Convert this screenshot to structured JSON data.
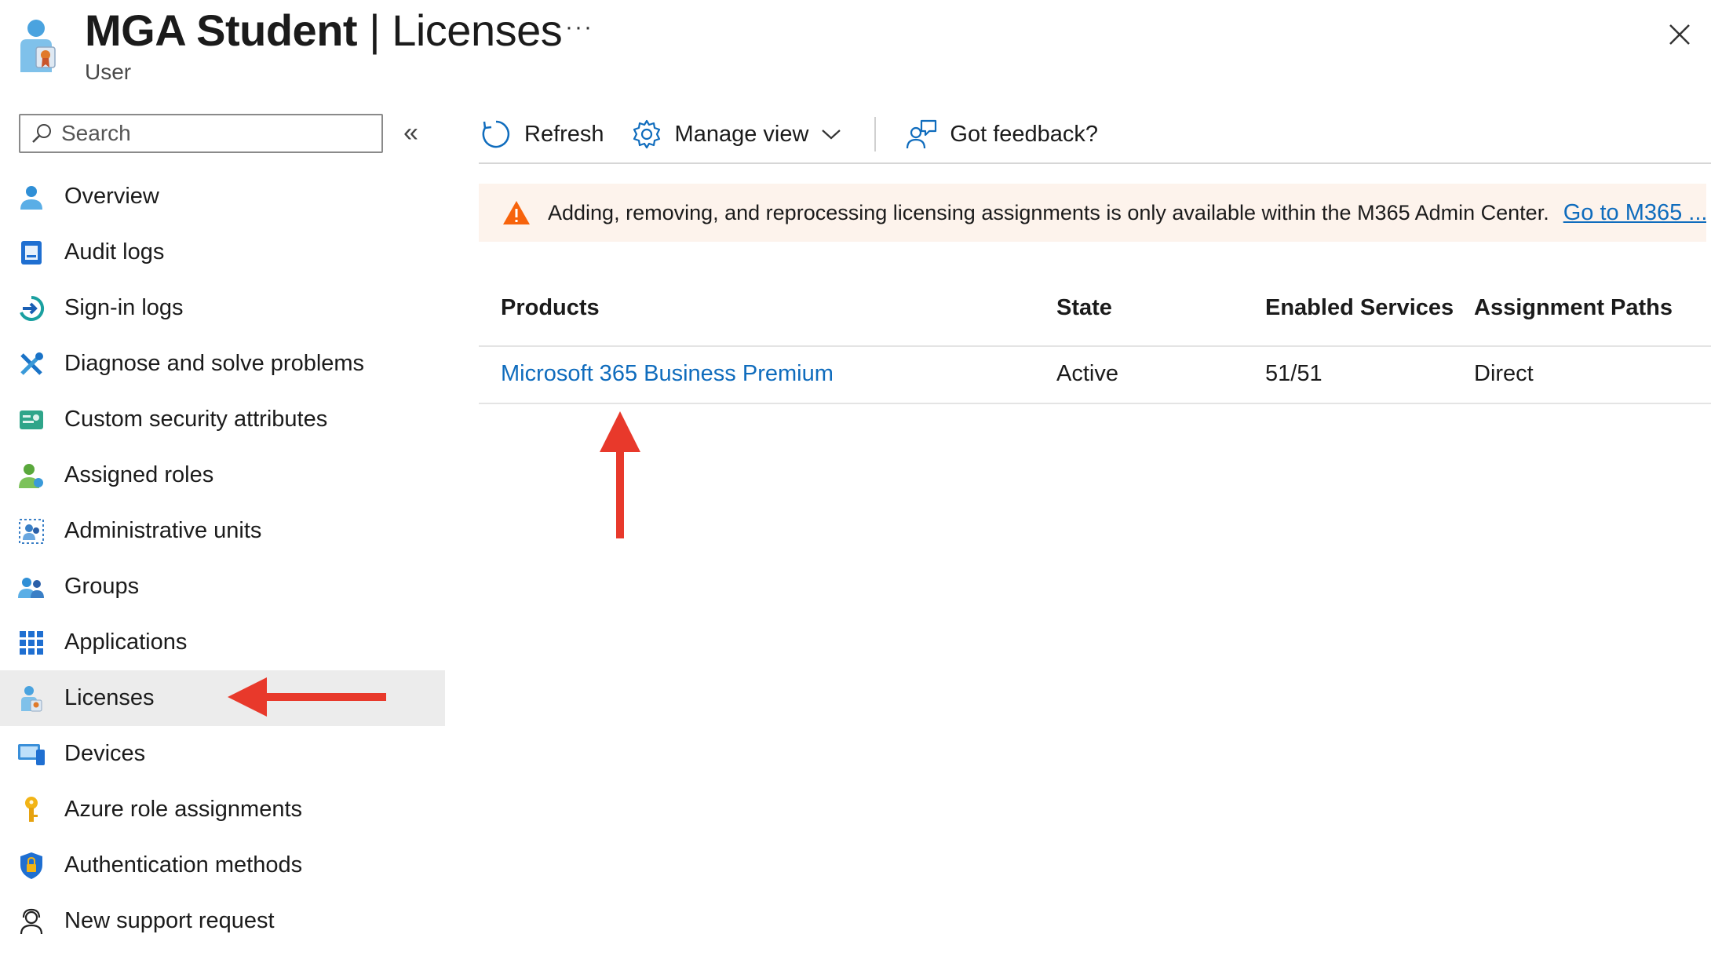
{
  "header": {
    "title": "MGA Student",
    "separator": "|",
    "section": "Licenses",
    "subtitle": "User",
    "more": "···"
  },
  "search": {
    "placeholder": "Search",
    "value": ""
  },
  "sidebar": {
    "collapse_glyph": "«",
    "items": [
      {
        "label": "Overview",
        "icon": "user-icon"
      },
      {
        "label": "Audit logs",
        "icon": "audit-log-icon"
      },
      {
        "label": "Sign-in logs",
        "icon": "sign-in-icon"
      },
      {
        "label": "Diagnose and solve problems",
        "icon": "wrench-icon"
      },
      {
        "label": "Custom security attributes",
        "icon": "security-attributes-icon"
      },
      {
        "label": "Assigned roles",
        "icon": "assigned-roles-icon"
      },
      {
        "label": "Administrative units",
        "icon": "admin-units-icon"
      },
      {
        "label": "Groups",
        "icon": "groups-icon"
      },
      {
        "label": "Applications",
        "icon": "applications-grid-icon"
      },
      {
        "label": "Licenses",
        "icon": "license-icon",
        "active": true
      },
      {
        "label": "Devices",
        "icon": "devices-icon"
      },
      {
        "label": "Azure role assignments",
        "icon": "key-icon"
      },
      {
        "label": "Authentication methods",
        "icon": "shield-lock-icon"
      },
      {
        "label": "New support request",
        "icon": "support-person-icon"
      }
    ]
  },
  "toolbar": {
    "refresh": "Refresh",
    "manage_view": "Manage view",
    "feedback": "Got feedback?"
  },
  "banner": {
    "message": "Adding, removing, and reprocessing licensing assignments is only available within the M365 Admin Center.",
    "link": "Go to M365 ..."
  },
  "table": {
    "columns": [
      "Products",
      "State",
      "Enabled Services",
      "Assignment Paths"
    ],
    "rows": [
      {
        "product": "Microsoft 365 Business Premium",
        "state": "Active",
        "enabled_services": "51/51",
        "assignment_paths": "Direct"
      }
    ]
  },
  "colors": {
    "link": "#0f6cbd",
    "warning": "#f7630c",
    "annotation_arrow": "#e8392b",
    "active_nav": "#ececec"
  }
}
